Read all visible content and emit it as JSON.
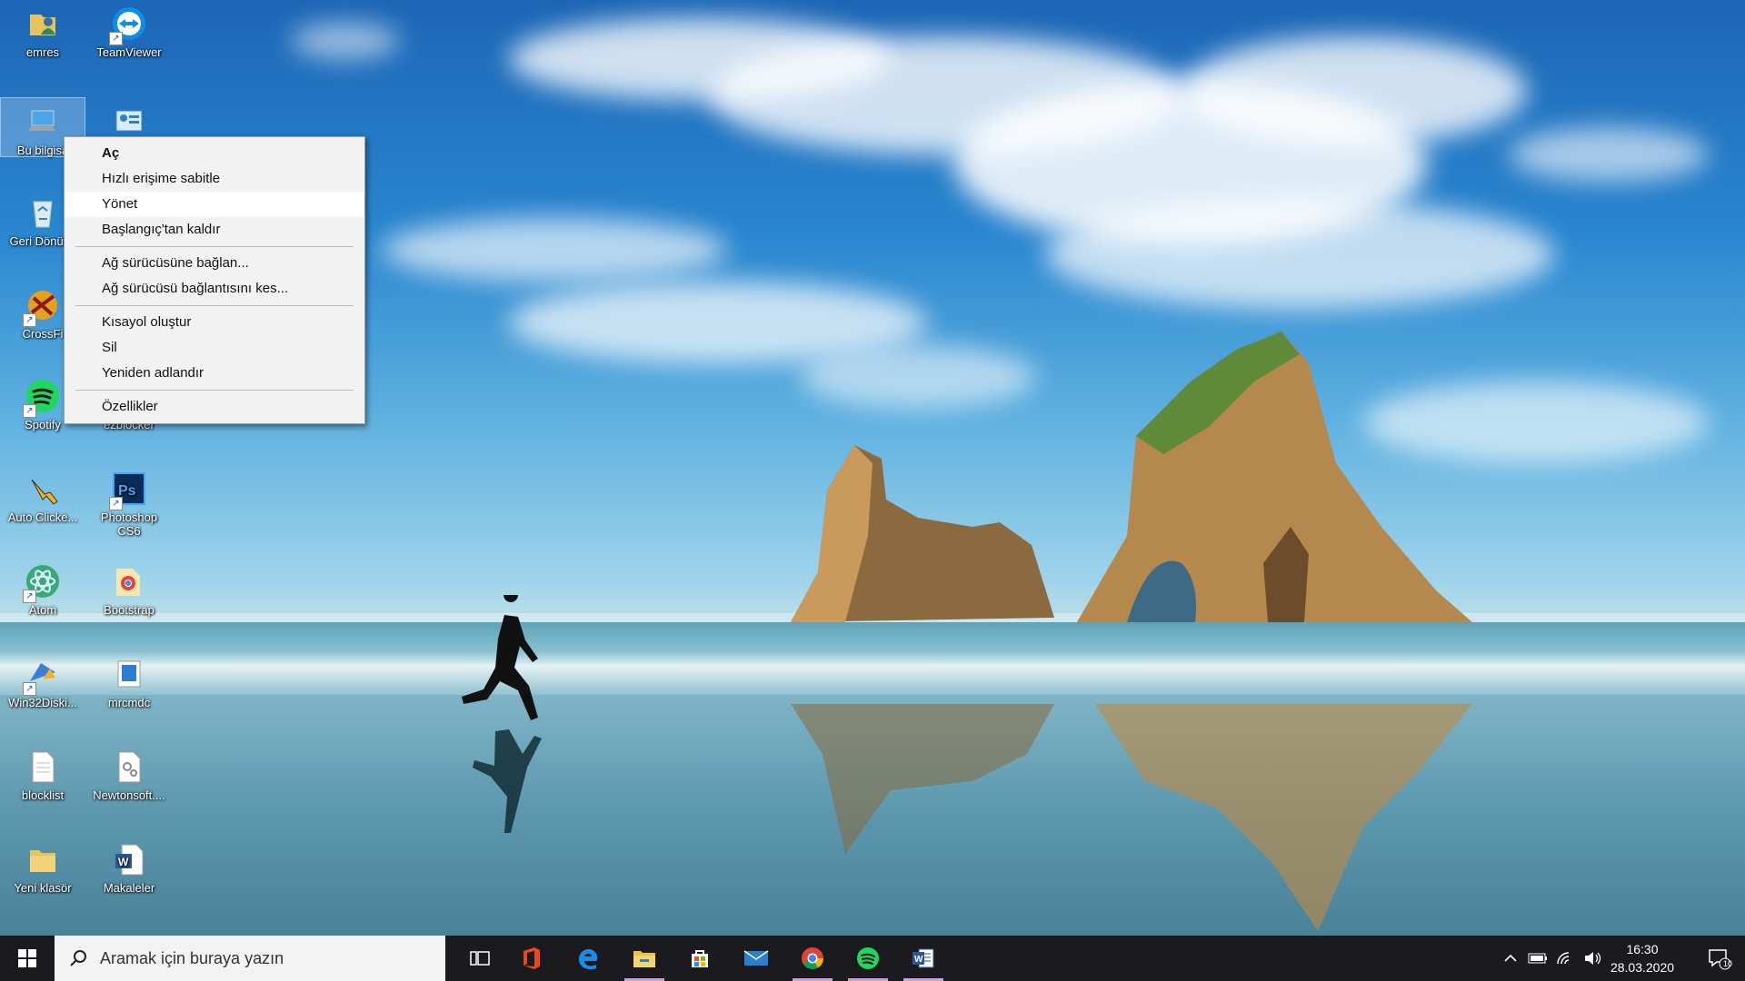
{
  "desktop_icons": [
    {
      "id": "emres",
      "label": "emres",
      "icon": "user-folder-icon"
    },
    {
      "id": "teamviewer",
      "label": "TeamViewer",
      "icon": "teamviewer-icon"
    },
    {
      "id": "this-pc",
      "label": "Bu bilgisa",
      "icon": "computer-icon"
    },
    {
      "id": "control",
      "label": "",
      "icon": "control-panel-icon"
    },
    {
      "id": "recycle",
      "label": "Geri Dönüşü",
      "icon": "recycle-bin-icon"
    },
    {
      "id": "crossfire",
      "label": "CrossFi",
      "icon": "crossfire-icon"
    },
    {
      "id": "spotify",
      "label": "Spotify",
      "icon": "spotify-icon"
    },
    {
      "id": "ezblocker",
      "label": "ezblocker",
      "icon": "ezblocker-icon"
    },
    {
      "id": "autoclicker",
      "label": "Auto Clicke...",
      "icon": "hand-cursor-icon"
    },
    {
      "id": "photoshop",
      "label": "Photoshop CS6",
      "icon": "photoshop-icon"
    },
    {
      "id": "atom",
      "label": "Atom",
      "icon": "atom-icon"
    },
    {
      "id": "bootstrap",
      "label": "Bootstrap",
      "icon": "chrome-folder-icon"
    },
    {
      "id": "win32disk",
      "label": "Win32Diski...",
      "icon": "disk-imager-icon"
    },
    {
      "id": "mrcmdc",
      "label": "mrcmdc",
      "icon": "window-app-icon"
    },
    {
      "id": "blocklist",
      "label": "blocklist",
      "icon": "text-file-icon"
    },
    {
      "id": "newtonsoft",
      "label": "Newtonsoft....",
      "icon": "settings-file-icon"
    },
    {
      "id": "newfolder",
      "label": "Yeni klasör",
      "icon": "folder-icon"
    },
    {
      "id": "makaleler",
      "label": "Makaleler",
      "icon": "word-document-icon"
    }
  ],
  "context_menu": {
    "items": [
      {
        "label": "Aç",
        "bold": true
      },
      {
        "label": "Hızlı erişime sabitle"
      },
      {
        "label": "Yönet",
        "hover": true
      },
      {
        "label": "Başlangıç'tan kaldır"
      },
      {
        "sep": true
      },
      {
        "label": "Ağ sürücüsüne bağlan..."
      },
      {
        "label": "Ağ sürücüsü bağlantısını kes..."
      },
      {
        "sep": true
      },
      {
        "label": "Kısayol oluştur"
      },
      {
        "label": "Sil"
      },
      {
        "label": "Yeniden adlandır"
      },
      {
        "sep": true
      },
      {
        "label": "Özellikler"
      }
    ]
  },
  "taskbar": {
    "search_placeholder": "Aramak için buraya yazın",
    "pinned": [
      {
        "icon": "task-view-icon",
        "running": false
      },
      {
        "icon": "office-icon",
        "running": false
      },
      {
        "icon": "edge-icon",
        "running": false
      },
      {
        "icon": "file-explorer-icon",
        "running": true
      },
      {
        "icon": "store-icon",
        "running": false
      },
      {
        "icon": "mail-icon",
        "running": false
      },
      {
        "icon": "chrome-icon",
        "running": true
      },
      {
        "icon": "spotify-icon",
        "running": true
      },
      {
        "icon": "word-icon",
        "running": true
      }
    ],
    "tray": {
      "time": "16:30",
      "date": "28.03.2020",
      "notifications": "10"
    },
    "colors": {
      "taskbar": "#1b1b1f",
      "running_indicator": "#c9a0dc"
    }
  }
}
